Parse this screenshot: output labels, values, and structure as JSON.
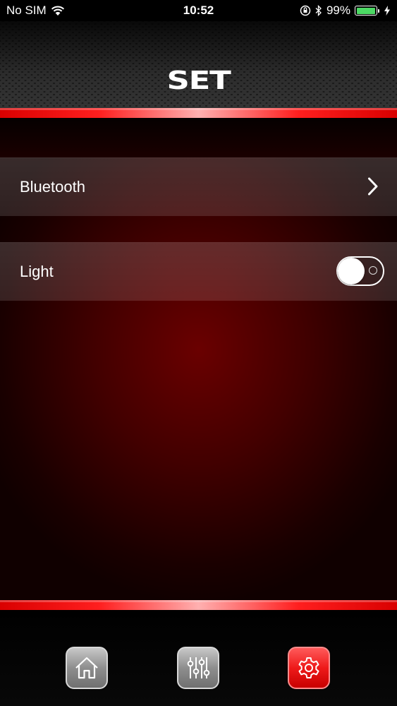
{
  "status_bar": {
    "carrier": "No SIM",
    "time": "10:52",
    "battery_percent": "99%",
    "battery_level": 0.99,
    "icons": [
      "wifi-icon",
      "orientation-lock-icon",
      "bluetooth-icon",
      "battery-icon",
      "charging-icon"
    ]
  },
  "header": {
    "title": "SET"
  },
  "settings": {
    "bluetooth_label": "Bluetooth",
    "light_label": "Light",
    "light_on": false
  },
  "tab_bar": {
    "items": [
      {
        "name": "home",
        "icon": "home-icon",
        "active": false
      },
      {
        "name": "equalizer",
        "icon": "sliders-icon",
        "active": false
      },
      {
        "name": "settings",
        "icon": "gear-icon",
        "active": true
      }
    ]
  },
  "colors": {
    "accent_red": "#ff1f1f",
    "background_red": "#5a0000",
    "battery_green": "#4cd964"
  }
}
